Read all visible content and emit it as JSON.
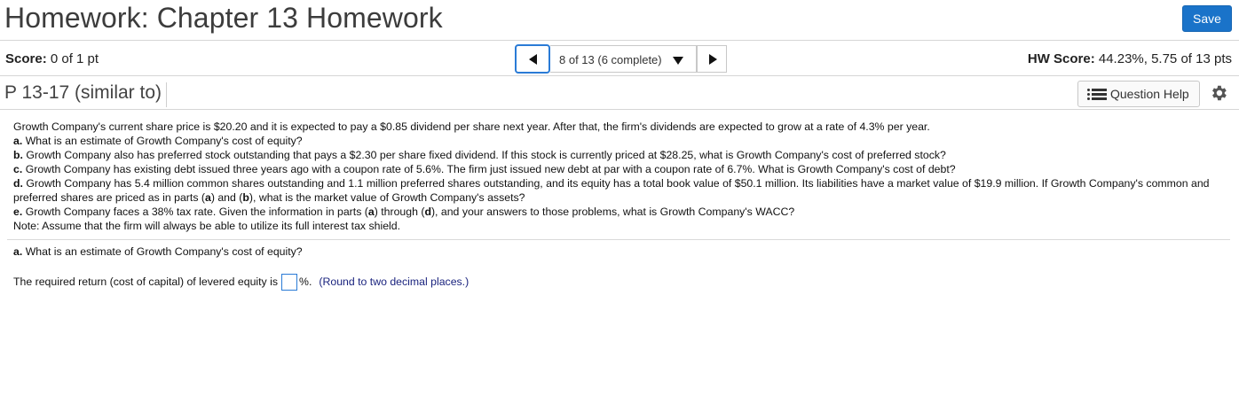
{
  "header": {
    "title": "Homework: Chapter 13 Homework",
    "save_label": "Save"
  },
  "score_bar": {
    "score_label": "Score:",
    "score_value": "0 of 1 pt",
    "nav_position": "8 of 13 (6 complete)",
    "hw_score_label": "HW Score:",
    "hw_score_value": "44.23%, 5.75 of 13 pts"
  },
  "problem_bar": {
    "problem_id": "P 13-17 (similar to)",
    "help_label": "Question Help"
  },
  "question": {
    "intro": "Growth Company's current share price is $20.20 and it is expected to pay a $0.85 dividend per share next year. After that, the firm's dividends are expected to grow at a rate of 4.3% per year.",
    "a_label": "a.",
    "a_text": "What is an estimate of Growth Company's cost of equity?",
    "b_label": "b.",
    "b_text": "Growth Company also has preferred stock outstanding that pays a $2.30 per share fixed dividend. If this stock is currently priced at $28.25, what is Growth Company's cost of preferred stock?",
    "c_label": "c.",
    "c_text": "Growth Company has existing debt issued three years ago with a coupon rate of 5.6%. The firm just issued new debt at par with a coupon rate of 6.7%. What is Growth Company's cost of debt?",
    "d_label": "d.",
    "d_text_1": "Growth Company has 5.4 million common shares outstanding and 1.1 million preferred shares outstanding, and its equity has a total book value of $50.1 million. Its liabilities have a market value of $19.9 million. If Growth Company's common and preferred shares are priced as in parts (",
    "d_ref_a": "a",
    "d_text_2": ") and (",
    "d_ref_b": "b",
    "d_text_3": "), what is the market value of Growth Company's assets?",
    "e_label": "e.",
    "e_text_1": "Growth Company faces a 38% tax rate. Given the information in parts (",
    "e_ref_a": "a",
    "e_text_2": ") through (",
    "e_ref_d": "d",
    "e_text_3": "), and your answers to those problems, what is Growth Company's WACC?",
    "note": "Note: Assume that the firm will always be able to utilize its full interest tax shield."
  },
  "current_part": {
    "label": "a.",
    "text": "What is an estimate of Growth Company's cost of equity?"
  },
  "answer": {
    "prefix": "The required return (cost of capital) of levered equity is",
    "value": "",
    "suffix": "%.",
    "hint": "(Round to two decimal places.)"
  },
  "colors": {
    "accent": "#1a73c9",
    "focus_border": "#2a7bd6",
    "hint_text": "#1a237e"
  }
}
